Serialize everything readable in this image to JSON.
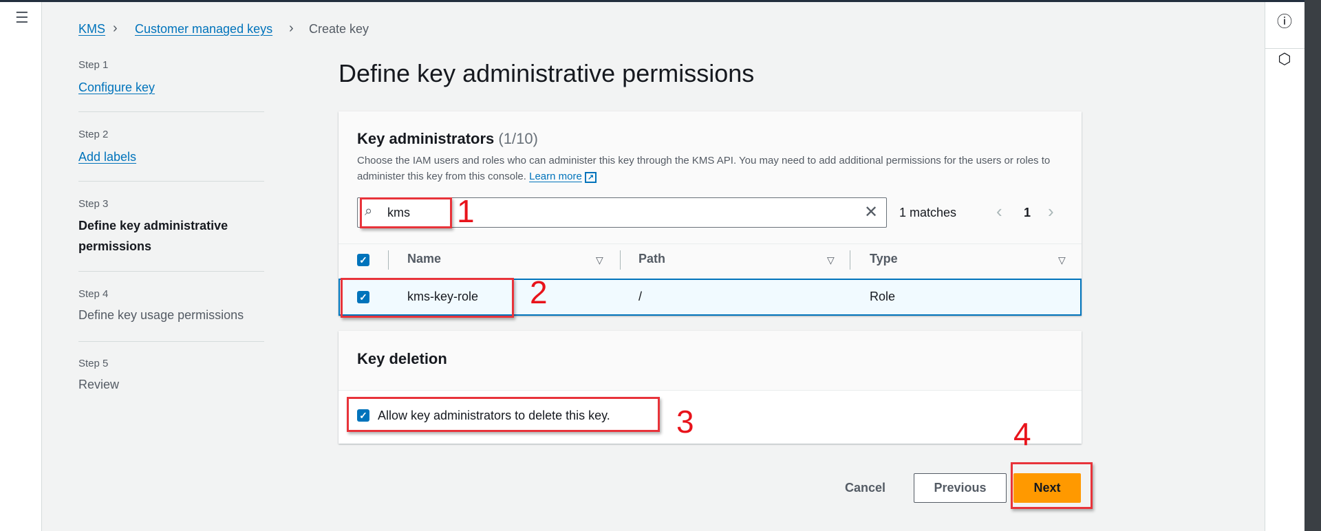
{
  "breadcrumb": [
    {
      "label": "KMS"
    },
    {
      "label": "Customer managed keys"
    },
    {
      "label": "Create key"
    }
  ],
  "steps": [
    {
      "step": "Step 1",
      "title": "Configure key",
      "state": "link"
    },
    {
      "step": "Step 2",
      "title": "Add labels",
      "state": "link"
    },
    {
      "step": "Step 3",
      "title": "Define key administrative permissions",
      "state": "current"
    },
    {
      "step": "Step 4",
      "title": "Define key usage permissions",
      "state": "disabled"
    },
    {
      "step": "Step 5",
      "title": "Review",
      "state": "disabled"
    }
  ],
  "page_title": "Define key administrative permissions",
  "admins": {
    "title": "Key administrators",
    "count": "(1/10)",
    "description": "Choose the IAM users and roles who can administer this key through the KMS API. You may need to add additional permissions for the users or roles to administer this key from this console.",
    "learn_more": "Learn more",
    "search_value": "kms",
    "matches": "1 matches",
    "page": "1",
    "columns": [
      "Name",
      "Path",
      "Type"
    ],
    "rows": [
      {
        "name": "kms-key-role",
        "path": "/",
        "type": "Role",
        "checked": true
      }
    ]
  },
  "deletion": {
    "title": "Key deletion",
    "checkbox_label": "Allow key administrators to delete this key.",
    "checked": true
  },
  "actions": {
    "cancel": "Cancel",
    "previous": "Previous",
    "next": "Next"
  },
  "annotations": [
    "1",
    "2",
    "3",
    "4"
  ],
  "colors": {
    "accent": "#0073bb",
    "primary_button": "#ff9900",
    "annotation": "#e8333a"
  },
  "icons": {
    "menu": "hamburger-icon",
    "info": "info-icon",
    "feedback": "hexagon-icon",
    "search": "search-icon",
    "clear": "close-icon",
    "external": "external-link-icon"
  }
}
